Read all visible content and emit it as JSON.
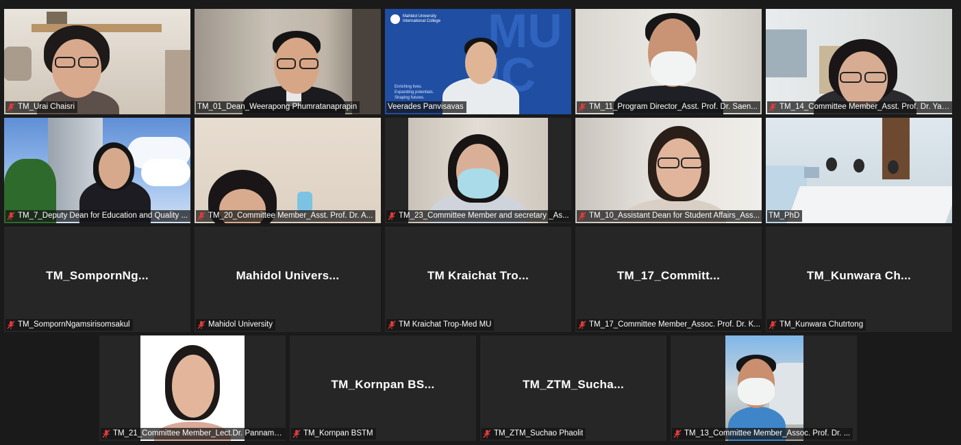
{
  "colors": {
    "background": "#1a1a1a",
    "tile_background": "#262626",
    "active_speaker_border": "#c5d95a",
    "muted_icon": "#e03b3b"
  },
  "participants": [
    {
      "label": "TM_Urai Chaisri",
      "muted": true
    },
    {
      "label": "TM_01_Dean_Weerapong Phumratanaprapin",
      "muted": false,
      "active_speaker": true
    },
    {
      "label": "Veerades Panvisavas",
      "muted": false,
      "background_text": [
        "Mahidol University",
        "International College",
        "Enriching lives.",
        "Expanding potentials.",
        "Shaping futures."
      ]
    },
    {
      "label": "TM_11_Program Director_Asst. Prof. Dr.  Saen...",
      "muted": true
    },
    {
      "label": "TM_14_Committee Member_Asst. Prof. Dr. Yan...",
      "muted": true
    },
    {
      "label": "TM_7_Deputy Dean for Education and Quality ...",
      "muted": true
    },
    {
      "label": "TM_20_Committee Member_Asst. Prof. Dr.  A...",
      "muted": true
    },
    {
      "label": "TM_23_Committee Member and secretary _As...",
      "muted": true
    },
    {
      "label": "TM_10_Assistant Dean for Student Affairs_Ass...",
      "muted": true
    },
    {
      "label": "TM_PhD",
      "muted": false
    },
    {
      "label": "TM_SompornNgamsirisomsakul",
      "display_name": "TM_SompornNg...",
      "muted": true
    },
    {
      "label": "Mahidol University",
      "display_name": "Mahidol  Univers...",
      "muted": true
    },
    {
      "label": "TM Kraichat Trop-Med MU",
      "display_name": "TM  Kraichat  Tro...",
      "muted": true
    },
    {
      "label": "TM_17_Committee Member_Assoc. Prof. Dr.  K...",
      "display_name": "TM_17_Committ...",
      "muted": true
    },
    {
      "label": "TM_Kunwara Chutrtong",
      "display_name": "TM_Kunwara  Ch...",
      "muted": true
    },
    {
      "label": "TM_21_Committee Member_Lect.Dr. Pannama...",
      "muted": true
    },
    {
      "label": "TM_Kornpan BSTM",
      "display_name": "TM_Kornpan  BS...",
      "muted": true
    },
    {
      "label": "TM_ZTM_Suchao Phaolit",
      "display_name": "TM_ZTM_Sucha...",
      "muted": true
    },
    {
      "label": "TM_13_Committee Member_Assoc. Prof. Dr.  ...",
      "muted": true
    }
  ]
}
